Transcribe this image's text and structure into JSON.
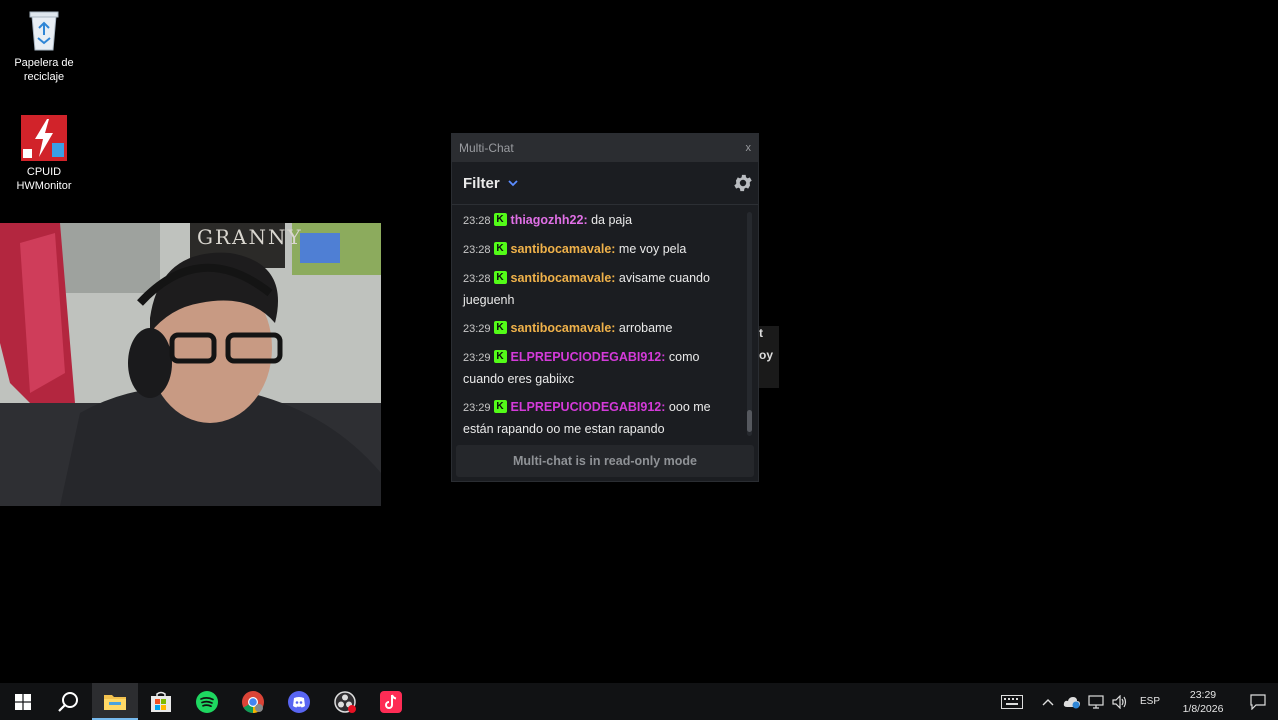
{
  "desktop": {
    "icons": [
      {
        "label": "Papelera de reciclaje",
        "icon": "recycle-bin-icon"
      },
      {
        "label": "CPUID HWMonitor",
        "icon": "hwmonitor-icon"
      }
    ]
  },
  "webcam": {
    "poster_text": "GRANNY"
  },
  "multichat": {
    "window_title": "Multi-Chat",
    "close_label": "x",
    "filter_label": "Filter",
    "messages": [
      {
        "time": "23:28",
        "user": "thiagozhh22:",
        "text": " da paja",
        "color": "#e070e6"
      },
      {
        "time": "23:28",
        "user": "santibocamavale:",
        "text": " me voy pela",
        "color": "#f0b24a"
      },
      {
        "time": "23:28",
        "user": "santibocamavale:",
        "text": " avisame cuando jueguenh",
        "color": "#f0b24a"
      },
      {
        "time": "23:29",
        "user": "santibocamavale:",
        "text": " arrobame",
        "color": "#f0b24a"
      },
      {
        "time": "23:29",
        "user": "ELPREPUCIODEGABI912:",
        "text": " como cuando eres gabiixc",
        "color": "#d43ad9"
      },
      {
        "time": "23:29",
        "user": "ELPREPUCIODEGABI912:",
        "text": " ooo me están rapando oo me estan rapando",
        "color": "#d43ad9"
      }
    ],
    "badge_letter": "K",
    "readonly_notice": "Multi-chat is in read-only mode"
  },
  "behind_window_text": {
    "line1": "t",
    "line2": "oy"
  },
  "taskbar": {
    "apps": [
      "start-icon",
      "search-icon",
      "file-explorer-icon",
      "microsoft-store-icon",
      "spotify-icon",
      "chrome-icon",
      "discord-icon",
      "obs-icon",
      "tiktok-icon"
    ],
    "language": "ESP",
    "time": "23:29",
    "date": "1/8/2026"
  },
  "colors": {
    "kick_green": "#53fc18",
    "accent_blue": "#76b9ed",
    "chat_bg": "#1b1d21"
  }
}
